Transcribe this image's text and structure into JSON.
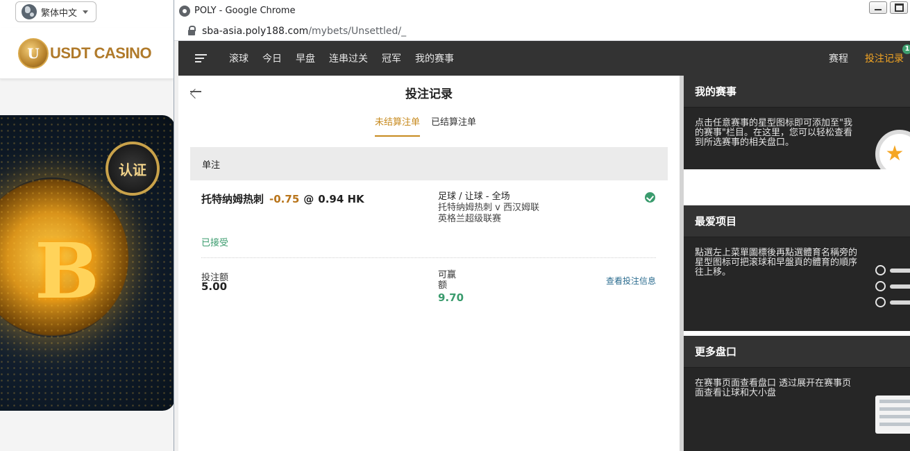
{
  "background": {
    "language": "繁体中文",
    "logo_text": "USDT CASINO",
    "logo_letter": "U",
    "badge_text": "认证",
    "coin_symbol": "B"
  },
  "browser": {
    "title": "POLY - Google Chrome",
    "url_host": "sba-asia.poly188.com",
    "url_path": "/mybets/Unsettled/_"
  },
  "nav": {
    "items": [
      "滚球",
      "今日",
      "早盘",
      "连串过关",
      "冠军",
      "我的赛事"
    ],
    "schedule": "赛程",
    "my_bets": "投注记录",
    "my_bets_count": "1"
  },
  "page": {
    "title": "投注记录",
    "tabs": [
      "未结算注单",
      "已结算注单"
    ],
    "section": "单注"
  },
  "bet": {
    "selection": "托特纳姆热刺",
    "handicap": "-0.75",
    "at": "@",
    "odds": "0.94 HK",
    "market": "足球 / 让球 - 全场",
    "match": "托特纳姆热刺 v 西汉姆联",
    "league": "英格兰超级联赛",
    "status": "已接受",
    "stake_label": "投注额",
    "stake_value": "5.00",
    "win_label": "可赢额",
    "win_value": "9.70",
    "detail_link": "查看投注信息"
  },
  "sidebar": {
    "my_events": {
      "title": "我的赛事",
      "text": "点击任意赛事的星型图标即可添加至\"我的赛事\"栏目。在这里，您可以轻松查看到所选赛事的相关盘口。"
    },
    "favorites": {
      "title": "最爱项目",
      "text": "點選左上菜單圖標後再點選體育名稱旁的星型图标可把滚球和早盤頁的體育的順序往上移。"
    },
    "more_markets": {
      "title": "更多盘口",
      "text": "在赛事页面查看盘口 透过展开在赛事页面查看让球和大小盘"
    }
  },
  "colors": {
    "accent_orange": "#f5a623",
    "handicap_brown": "#b8741a",
    "success_green": "#3a9b6d",
    "nav_bg": "#333333"
  }
}
